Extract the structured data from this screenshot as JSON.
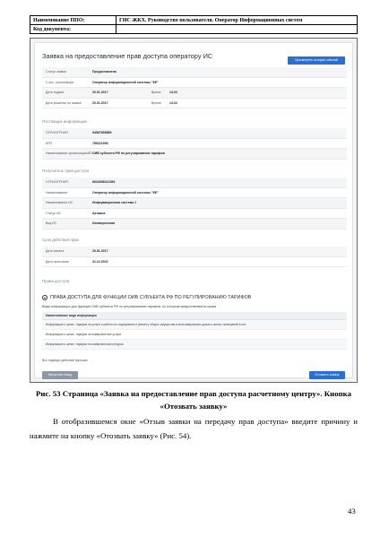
{
  "header": {
    "software_label": "Наименование ППО:",
    "software_value": "ГИС ЖКХ. Руководство пользователя. Оператор Информационных систем",
    "doc_code_label": "Код документа:",
    "doc_code_value": ""
  },
  "screen": {
    "title": "Заявка на предоставление прав доступа оператору ИС",
    "history_button": "Просмотреть историю событий",
    "status_rows": [
      {
        "label": "Статус заявки",
        "value": "Предоставлена",
        "label2": "",
        "value2": ""
      },
      {
        "label": "С исх. организация",
        "value": "Оператор информационной системы \"ЕЕ\"",
        "label2": "",
        "value2": ""
      },
      {
        "label": "Дата подачи",
        "value": "20.01.2017",
        "label2": "Время",
        "value2": "14:22"
      },
      {
        "label": "Дата решения по заявке",
        "value": "20.01.2017",
        "label2": "Время",
        "value2": "14:22"
      }
    ],
    "provider_section": "Поставщик информации",
    "provider_rows": [
      {
        "label": "ОГРН/ОГРНИП",
        "value": "54567655689"
      },
      {
        "label": "КПП",
        "value": "785221556"
      },
      {
        "label": "Наименование организации/ИП",
        "value": "ОИВ субъекта РФ по регулированию тарифов"
      }
    ],
    "receiver_section": "Получатель прав доступа",
    "receiver_rows": [
      {
        "label": "ОГРН/ОГРНИП",
        "value": "6632658412269"
      },
      {
        "label": "Наименование",
        "value": "Оператор информационной системы \"ЕЕ\""
      },
      {
        "label": "Наименование ИС",
        "value": "Информационная система 1"
      },
      {
        "label": "Статус ИС",
        "value": "Активна"
      },
      {
        "label": "Вид ИС",
        "value": "Коммерческая"
      }
    ],
    "period_section": "Срок действия прав",
    "period_rows": [
      {
        "label": "Дата начала",
        "value": "20.01.2017"
      },
      {
        "label": "Дата окончания",
        "value": "31.12.2022"
      }
    ],
    "rights_section": "Права доступа",
    "rights_title": "ПРАВА ДОСТУПА ДЛЯ ФУНКЦИИ ОИВ СУБЪЕКТА РФ ПО РЕГУЛИРОВАНИЮ ТАРИФОВ",
    "kinds_label": "Виды информации для функции ОИВ субъекта РФ по регулированию тарифов, по которым предоставляются права",
    "table_header": "Наименование вида информации",
    "table_rows": [
      "Информация о ценах, тарифах на услуги и работы по содержанию и ремонту общего имущества в многоквартирных домах и жилых помещений в них",
      "Информация о ценах, тарифах на коммунальные услуги",
      "Информация о ценах, тарифах на коммунальные ресурсы"
    ],
    "all_kinds": "Все подвиды действий функции",
    "back_button": "Вернуться назад",
    "recall_button": "Отозвать заявку"
  },
  "caption": "Рис. 53 Страница «Заявка на предоставление прав доступа расчетному центру». Кнопка «Отозвать заявку»",
  "paragraph": "В отобразившемся окне «Отзыв заявки на передачу прав доступа» введите причину и нажмите на кнопку «Отозвать заявку» (Рис. 54).",
  "page_number": "43"
}
